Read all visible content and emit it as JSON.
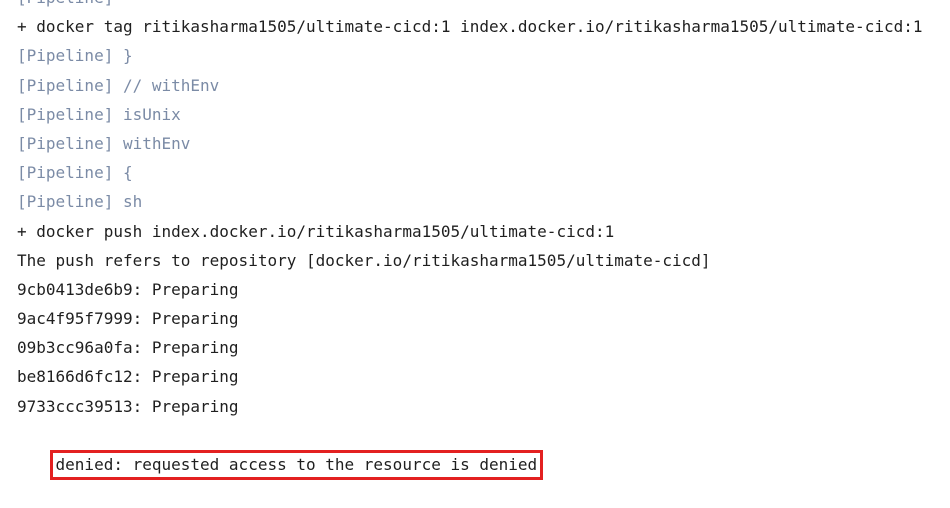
{
  "console": {
    "lines": [
      {
        "text": "[Pipeline]",
        "kind": "pipeline"
      },
      {
        "text": "+ docker tag ritikasharma1505/ultimate-cicd:1 index.docker.io/ritikasharma1505/ultimate-cicd:1",
        "kind": "output"
      },
      {
        "text": "[Pipeline] }",
        "kind": "pipeline"
      },
      {
        "text": "[Pipeline] // withEnv",
        "kind": "pipeline"
      },
      {
        "text": "[Pipeline] isUnix",
        "kind": "pipeline"
      },
      {
        "text": "[Pipeline] withEnv",
        "kind": "pipeline"
      },
      {
        "text": "[Pipeline] {",
        "kind": "pipeline"
      },
      {
        "text": "[Pipeline] sh",
        "kind": "pipeline"
      },
      {
        "text": "+ docker push index.docker.io/ritikasharma1505/ultimate-cicd:1",
        "kind": "output"
      },
      {
        "text": "The push refers to repository [docker.io/ritikasharma1505/ultimate-cicd]",
        "kind": "output"
      },
      {
        "text": "9cb0413de6b9: Preparing",
        "kind": "output"
      },
      {
        "text": "9ac4f95f7999: Preparing",
        "kind": "output"
      },
      {
        "text": "09b3cc96a0fa: Preparing",
        "kind": "output"
      },
      {
        "text": "be8166d6fc12: Preparing",
        "kind": "output"
      },
      {
        "text": "9733ccc39513: Preparing",
        "kind": "output"
      },
      {
        "text": "denied: requested access to the resource is denied",
        "kind": "error-highlighted"
      }
    ]
  },
  "colors": {
    "pipeline_text": "#7b8ba6",
    "output_text": "#1f1f1f",
    "highlight_border": "#e32020"
  }
}
